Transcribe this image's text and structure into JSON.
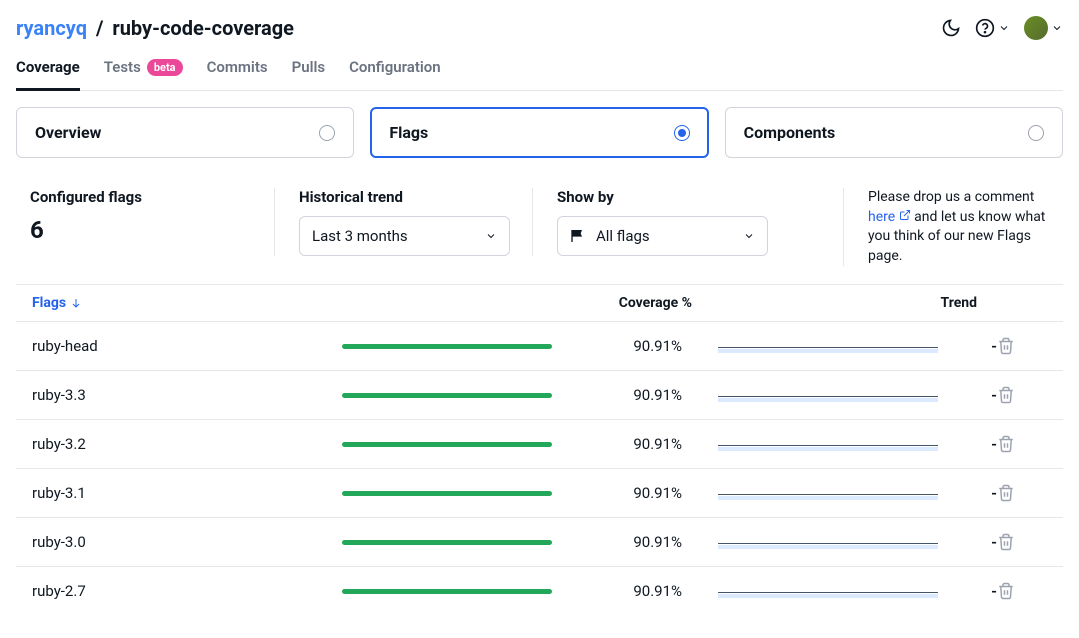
{
  "breadcrumb": {
    "owner": "ryancyq",
    "separator": "/",
    "repo": "ruby-code-coverage"
  },
  "nav_tabs": {
    "coverage": "Coverage",
    "tests": "Tests",
    "tests_badge": "beta",
    "commits": "Commits",
    "pulls": "Pulls",
    "configuration": "Configuration"
  },
  "sub_tabs": {
    "overview": "Overview",
    "flags": "Flags",
    "components": "Components"
  },
  "controls": {
    "configured_title": "Configured flags",
    "configured_count": "6",
    "trend_title": "Historical trend",
    "trend_value": "Last 3 months",
    "showby_title": "Show by",
    "showby_value": "All flags",
    "feedback_pre": "Please drop us a comment ",
    "feedback_link": "here",
    "feedback_post": " and let us know what you think of our new Flags page."
  },
  "columns": {
    "flags": "Flags",
    "coverage": "Coverage %",
    "trend": "Trend"
  },
  "rows": [
    {
      "name": "ruby-head",
      "pct": "90.91%",
      "trend": "-"
    },
    {
      "name": "ruby-3.3",
      "pct": "90.91%",
      "trend": "-"
    },
    {
      "name": "ruby-3.2",
      "pct": "90.91%",
      "trend": "-"
    },
    {
      "name": "ruby-3.1",
      "pct": "90.91%",
      "trend": "-"
    },
    {
      "name": "ruby-3.0",
      "pct": "90.91%",
      "trend": "-"
    },
    {
      "name": "ruby-2.7",
      "pct": "90.91%",
      "trend": "-"
    }
  ]
}
